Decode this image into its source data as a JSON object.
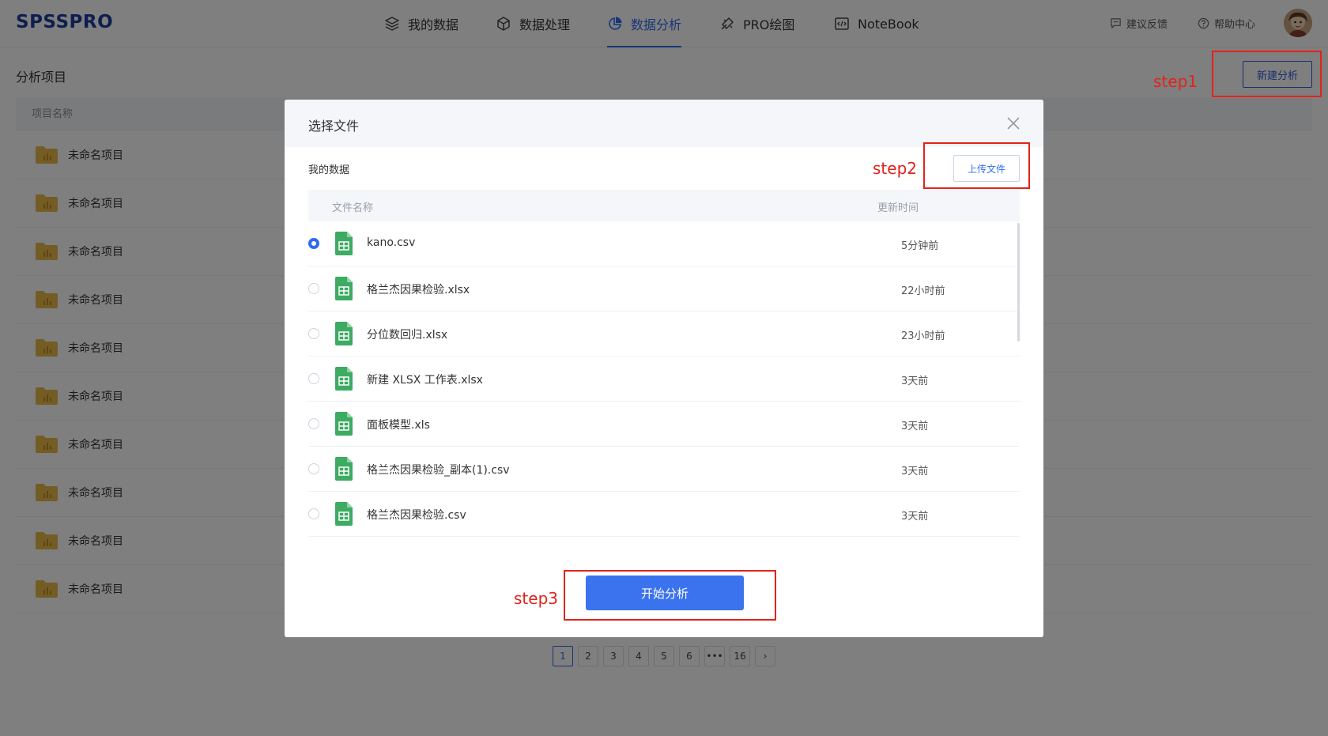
{
  "app": {
    "logo": "SPSSPRO"
  },
  "nav": {
    "items": [
      {
        "label": "我的数据",
        "icon": "layers-icon"
      },
      {
        "label": "数据处理",
        "icon": "cube-icon"
      },
      {
        "label": "数据分析",
        "icon": "pie-chart-icon",
        "active": true
      },
      {
        "label": "PRO绘图",
        "icon": "brush-icon"
      },
      {
        "label": "NoteBook",
        "icon": "code-icon"
      }
    ],
    "feedback": "建议反馈",
    "help": "帮助中心"
  },
  "page": {
    "title": "分析项目",
    "new_button": "新建分析",
    "list_header": "项目名称",
    "projects": [
      "未命名项目",
      "未命名项目",
      "未命名项目",
      "未命名项目",
      "未命名项目",
      "未命名项目",
      "未命名项目",
      "未命名项目",
      "未命名项目",
      "未命名项目"
    ],
    "pagination": [
      "1",
      "2",
      "3",
      "4",
      "5",
      "6",
      "•••",
      "16",
      "›"
    ],
    "current_page": "1"
  },
  "modal": {
    "title": "选择文件",
    "section": "我的数据",
    "upload_button": "上传文件",
    "col_name": "文件名称",
    "col_time": "更新时间",
    "files": [
      {
        "name": "kano.csv",
        "time": "5分钟前",
        "selected": true
      },
      {
        "name": "格兰杰因果检验.xlsx",
        "time": "22小时前",
        "selected": false
      },
      {
        "name": "分位数回归.xlsx",
        "time": "23小时前",
        "selected": false
      },
      {
        "name": "新建 XLSX 工作表.xlsx",
        "time": "3天前",
        "selected": false
      },
      {
        "name": "面板模型.xls",
        "time": "3天前",
        "selected": false
      },
      {
        "name": "格兰杰因果检验_副本(1).csv",
        "time": "3天前",
        "selected": false
      },
      {
        "name": "格兰杰因果检验.csv",
        "time": "3天前",
        "selected": false
      }
    ],
    "start_button": "开始分析"
  },
  "annotations": {
    "step1": "step1",
    "step2": "step2",
    "step3": "step3",
    "color": "#e2231a"
  },
  "colors": {
    "brand": "#1f3c9c",
    "accent": "#2f6bf0",
    "annotation": "#e2231a"
  }
}
